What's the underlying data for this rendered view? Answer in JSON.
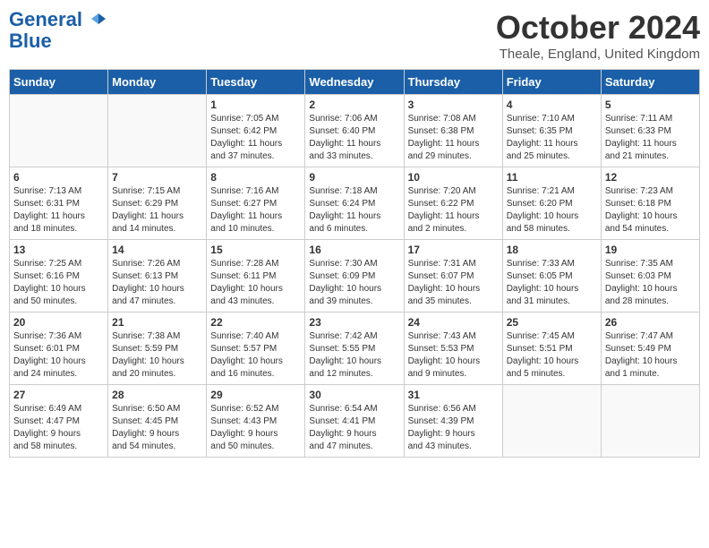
{
  "header": {
    "logo_line1": "General",
    "logo_line2": "Blue",
    "month": "October 2024",
    "location": "Theale, England, United Kingdom"
  },
  "days_of_week": [
    "Sunday",
    "Monday",
    "Tuesday",
    "Wednesday",
    "Thursday",
    "Friday",
    "Saturday"
  ],
  "weeks": [
    [
      {
        "day": "",
        "info": ""
      },
      {
        "day": "",
        "info": ""
      },
      {
        "day": "1",
        "info": "Sunrise: 7:05 AM\nSunset: 6:42 PM\nDaylight: 11 hours\nand 37 minutes."
      },
      {
        "day": "2",
        "info": "Sunrise: 7:06 AM\nSunset: 6:40 PM\nDaylight: 11 hours\nand 33 minutes."
      },
      {
        "day": "3",
        "info": "Sunrise: 7:08 AM\nSunset: 6:38 PM\nDaylight: 11 hours\nand 29 minutes."
      },
      {
        "day": "4",
        "info": "Sunrise: 7:10 AM\nSunset: 6:35 PM\nDaylight: 11 hours\nand 25 minutes."
      },
      {
        "day": "5",
        "info": "Sunrise: 7:11 AM\nSunset: 6:33 PM\nDaylight: 11 hours\nand 21 minutes."
      }
    ],
    [
      {
        "day": "6",
        "info": "Sunrise: 7:13 AM\nSunset: 6:31 PM\nDaylight: 11 hours\nand 18 minutes."
      },
      {
        "day": "7",
        "info": "Sunrise: 7:15 AM\nSunset: 6:29 PM\nDaylight: 11 hours\nand 14 minutes."
      },
      {
        "day": "8",
        "info": "Sunrise: 7:16 AM\nSunset: 6:27 PM\nDaylight: 11 hours\nand 10 minutes."
      },
      {
        "day": "9",
        "info": "Sunrise: 7:18 AM\nSunset: 6:24 PM\nDaylight: 11 hours\nand 6 minutes."
      },
      {
        "day": "10",
        "info": "Sunrise: 7:20 AM\nSunset: 6:22 PM\nDaylight: 11 hours\nand 2 minutes."
      },
      {
        "day": "11",
        "info": "Sunrise: 7:21 AM\nSunset: 6:20 PM\nDaylight: 10 hours\nand 58 minutes."
      },
      {
        "day": "12",
        "info": "Sunrise: 7:23 AM\nSunset: 6:18 PM\nDaylight: 10 hours\nand 54 minutes."
      }
    ],
    [
      {
        "day": "13",
        "info": "Sunrise: 7:25 AM\nSunset: 6:16 PM\nDaylight: 10 hours\nand 50 minutes."
      },
      {
        "day": "14",
        "info": "Sunrise: 7:26 AM\nSunset: 6:13 PM\nDaylight: 10 hours\nand 47 minutes."
      },
      {
        "day": "15",
        "info": "Sunrise: 7:28 AM\nSunset: 6:11 PM\nDaylight: 10 hours\nand 43 minutes."
      },
      {
        "day": "16",
        "info": "Sunrise: 7:30 AM\nSunset: 6:09 PM\nDaylight: 10 hours\nand 39 minutes."
      },
      {
        "day": "17",
        "info": "Sunrise: 7:31 AM\nSunset: 6:07 PM\nDaylight: 10 hours\nand 35 minutes."
      },
      {
        "day": "18",
        "info": "Sunrise: 7:33 AM\nSunset: 6:05 PM\nDaylight: 10 hours\nand 31 minutes."
      },
      {
        "day": "19",
        "info": "Sunrise: 7:35 AM\nSunset: 6:03 PM\nDaylight: 10 hours\nand 28 minutes."
      }
    ],
    [
      {
        "day": "20",
        "info": "Sunrise: 7:36 AM\nSunset: 6:01 PM\nDaylight: 10 hours\nand 24 minutes."
      },
      {
        "day": "21",
        "info": "Sunrise: 7:38 AM\nSunset: 5:59 PM\nDaylight: 10 hours\nand 20 minutes."
      },
      {
        "day": "22",
        "info": "Sunrise: 7:40 AM\nSunset: 5:57 PM\nDaylight: 10 hours\nand 16 minutes."
      },
      {
        "day": "23",
        "info": "Sunrise: 7:42 AM\nSunset: 5:55 PM\nDaylight: 10 hours\nand 12 minutes."
      },
      {
        "day": "24",
        "info": "Sunrise: 7:43 AM\nSunset: 5:53 PM\nDaylight: 10 hours\nand 9 minutes."
      },
      {
        "day": "25",
        "info": "Sunrise: 7:45 AM\nSunset: 5:51 PM\nDaylight: 10 hours\nand 5 minutes."
      },
      {
        "day": "26",
        "info": "Sunrise: 7:47 AM\nSunset: 5:49 PM\nDaylight: 10 hours\nand 1 minute."
      }
    ],
    [
      {
        "day": "27",
        "info": "Sunrise: 6:49 AM\nSunset: 4:47 PM\nDaylight: 9 hours\nand 58 minutes."
      },
      {
        "day": "28",
        "info": "Sunrise: 6:50 AM\nSunset: 4:45 PM\nDaylight: 9 hours\nand 54 minutes."
      },
      {
        "day": "29",
        "info": "Sunrise: 6:52 AM\nSunset: 4:43 PM\nDaylight: 9 hours\nand 50 minutes."
      },
      {
        "day": "30",
        "info": "Sunrise: 6:54 AM\nSunset: 4:41 PM\nDaylight: 9 hours\nand 47 minutes."
      },
      {
        "day": "31",
        "info": "Sunrise: 6:56 AM\nSunset: 4:39 PM\nDaylight: 9 hours\nand 43 minutes."
      },
      {
        "day": "",
        "info": ""
      },
      {
        "day": "",
        "info": ""
      }
    ]
  ]
}
